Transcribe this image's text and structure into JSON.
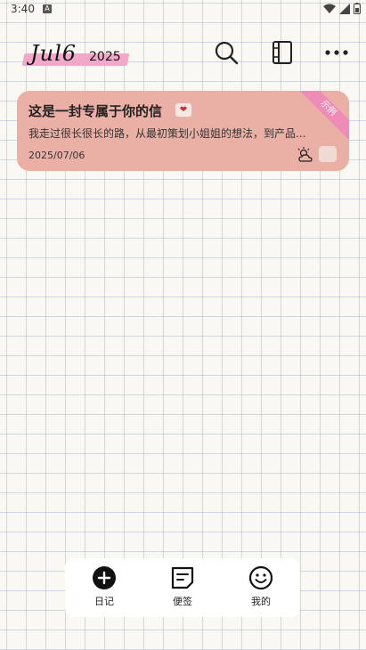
{
  "status": {
    "time": "3:40",
    "notify_letter": "A"
  },
  "header": {
    "month": "Jul6",
    "year": "2025"
  },
  "entry": {
    "title": "这是一封专属于你的信",
    "badge": "示例",
    "excerpt": "我走过很长很长的路，从最初策划小姐姐的想法，到产品...",
    "date": "2025/07/06",
    "card_color": "#ebb0a5",
    "badge_color": "#ee8bb6"
  },
  "nav": {
    "diary": "日记",
    "notes": "便签",
    "mine": "我的"
  },
  "icons": {
    "search": "search-icon",
    "notebook": "notebook-icon",
    "more": "more-icon",
    "weather": "sun-cloud-icon",
    "add": "plus-circle-icon",
    "note": "note-icon",
    "smile": "smile-icon"
  }
}
